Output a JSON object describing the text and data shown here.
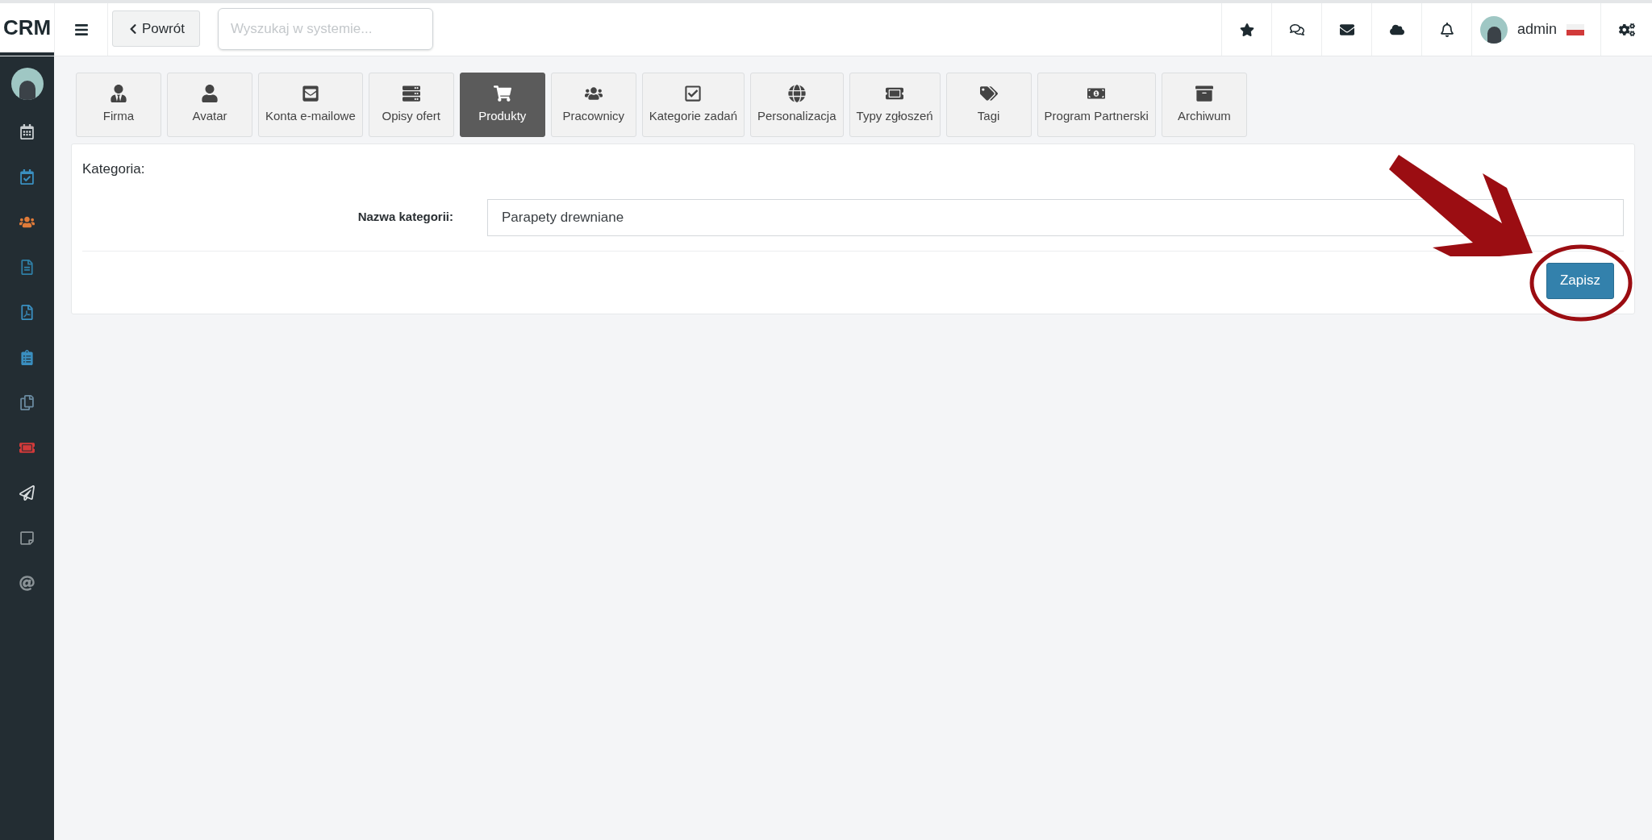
{
  "topbar": {
    "logo": "CRM",
    "back_button": "Powrót",
    "search": {
      "placeholder": "Wyszukaj w systemie..."
    },
    "user": "admin"
  },
  "sidebar": {
    "items": [
      {
        "color": "#c9ced1"
      },
      {
        "color": "#3a8fc0"
      },
      {
        "color": "#e07b39"
      },
      {
        "color": "#2f7fa6"
      },
      {
        "color": "#3a8fc0"
      },
      {
        "color": "#3a8fc0"
      },
      {
        "color": "#6a8aa0"
      },
      {
        "color": "#d23a3a"
      },
      {
        "color": "#d8dcde"
      },
      {
        "color": "#8a9296"
      },
      {
        "color": "#8a9296"
      }
    ]
  },
  "tabs": [
    {
      "label": "Firma",
      "selected": false
    },
    {
      "label": "Avatar",
      "selected": false
    },
    {
      "label": "Konta e-mailowe",
      "selected": false
    },
    {
      "label": "Opisy ofert",
      "selected": false
    },
    {
      "label": "Produkty",
      "selected": true
    },
    {
      "label": "Pracownicy",
      "selected": false
    },
    {
      "label": "Kategorie zadań",
      "selected": false
    },
    {
      "label": "Personalizacja",
      "selected": false
    },
    {
      "label": "Typy zgłoszeń",
      "selected": false
    },
    {
      "label": "Tagi",
      "selected": false
    },
    {
      "label": "Program Partnerski",
      "selected": false
    },
    {
      "label": "Archiwum",
      "selected": false
    }
  ],
  "form": {
    "title": "Kategoria:",
    "field": {
      "label": "Nazwa kategorii:",
      "value": "Parapety drewniane"
    },
    "save_button": "Zapisz"
  }
}
